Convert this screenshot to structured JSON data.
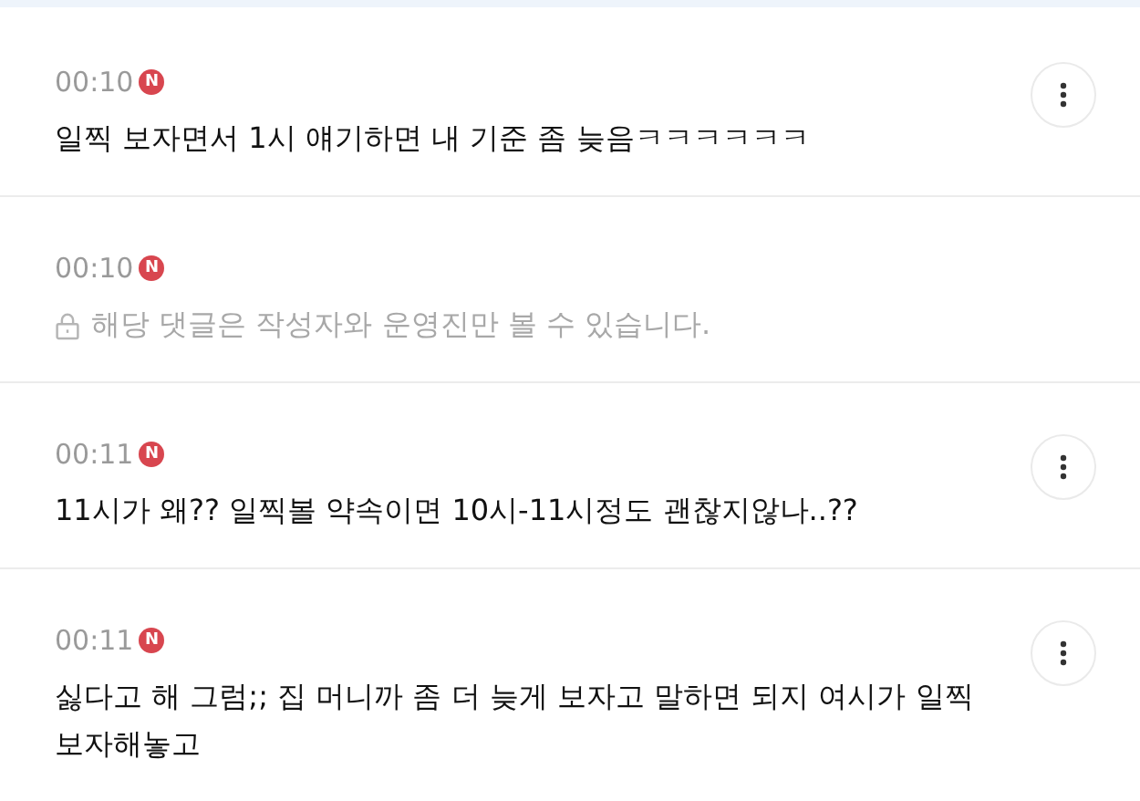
{
  "comments": [
    {
      "kind": "public",
      "time": "00:10",
      "badge": "N",
      "text": "일찍 보자면서 1시 얘기하면 내 기준 좀 늦음ㅋㅋㅋㅋㅋㅋ"
    },
    {
      "kind": "private",
      "time": "00:10",
      "badge": "N",
      "text": "해당 댓글은 작성자와 운영진만 볼 수 있습니다."
    },
    {
      "kind": "public",
      "time": "00:11",
      "badge": "N",
      "text": "11시가 왜?? 일찍볼 약속이면 10시-11시정도 괜찮지않나..??"
    },
    {
      "kind": "public",
      "time": "00:11",
      "badge": "N",
      "text": "싫다고 해 그럼;; 집 머니까 좀 더 늦게 보자고 말하면 되지 여시가 일찍 보자해놓고"
    }
  ]
}
